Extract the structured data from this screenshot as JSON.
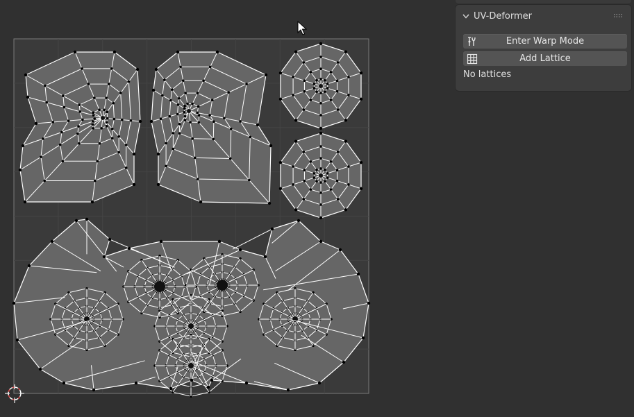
{
  "panel": {
    "title": "UV-Deformer",
    "buttons": [
      {
        "label": "Enter Warp Mode",
        "icon": "warp-tool-icon"
      },
      {
        "label": "Add Lattice",
        "icon": "lattice-grid-icon"
      }
    ],
    "status": "No lattices"
  },
  "colors": {
    "background": "#303030",
    "uv_bounds_fill": "#3a3a3a",
    "uv_face_fill": "#666666",
    "uv_edge": "#ffffff",
    "uv_vertex": "#000000",
    "panel_bg": "#3d3d3d",
    "button_bg": "#545454",
    "origin_accent": "#d44"
  }
}
